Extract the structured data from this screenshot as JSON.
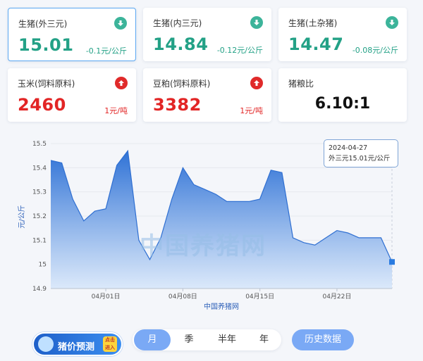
{
  "cards": [
    {
      "title": "生猪(外三元)",
      "value": "15.01",
      "change": "-0.1元/公斤",
      "direction": "down",
      "active": true
    },
    {
      "title": "生猪(内三元)",
      "value": "14.84",
      "change": "-0.12元/公斤",
      "direction": "down",
      "active": false
    },
    {
      "title": "生猪(土杂猪)",
      "value": "14.47",
      "change": "-0.08元/公斤",
      "direction": "down",
      "active": false
    },
    {
      "title": "玉米(饲料原料)",
      "value": "2460",
      "change": "1元/吨",
      "direction": "up",
      "active": false
    },
    {
      "title": "豆粕(饲料原料)",
      "value": "3382",
      "change": "1元/吨",
      "direction": "up",
      "active": false
    },
    {
      "title": "猪粮比",
      "value": "6.10:1"
    }
  ],
  "chart_data": {
    "type": "area",
    "ylabel": "元/公斤",
    "xlabel": "中国养猪网",
    "ylim": [
      14.9,
      15.5
    ],
    "yticks": [
      "15.5",
      "15.4",
      "15.3",
      "15.2",
      "15.1",
      "15",
      "14.9"
    ],
    "xticks": [
      "04月01日",
      "04月08日",
      "04月15日",
      "04月22日"
    ],
    "x": [
      "03-27",
      "03-28",
      "03-29",
      "03-30",
      "03-31",
      "04-01",
      "04-02",
      "04-03",
      "04-04",
      "04-05",
      "04-06",
      "04-07",
      "04-08",
      "04-09",
      "04-10",
      "04-11",
      "04-12",
      "04-13",
      "04-14",
      "04-15",
      "04-16",
      "04-17",
      "04-18",
      "04-19",
      "04-20",
      "04-21",
      "04-22",
      "04-23",
      "04-24",
      "04-25",
      "04-26",
      "04-27"
    ],
    "values": [
      15.43,
      15.42,
      15.27,
      15.18,
      15.22,
      15.23,
      15.41,
      15.47,
      15.1,
      15.02,
      15.11,
      15.27,
      15.4,
      15.33,
      15.31,
      15.29,
      15.26,
      15.26,
      15.26,
      15.27,
      15.39,
      15.38,
      15.11,
      15.09,
      15.08,
      15.11,
      15.14,
      15.13,
      15.11,
      15.11,
      15.11,
      15.01
    ],
    "grid": true,
    "color": "#2f6fd1"
  },
  "tooltip": {
    "date": "2024-04-27",
    "text": "外三元15.01元/公斤"
  },
  "watermark": "中国养猪网",
  "controls": {
    "predict_label": "猪价预测",
    "predict_tag": "点击进入",
    "periods": [
      "月",
      "季",
      "半年",
      "年"
    ],
    "active_period": "月",
    "history_label": "历史数据"
  }
}
